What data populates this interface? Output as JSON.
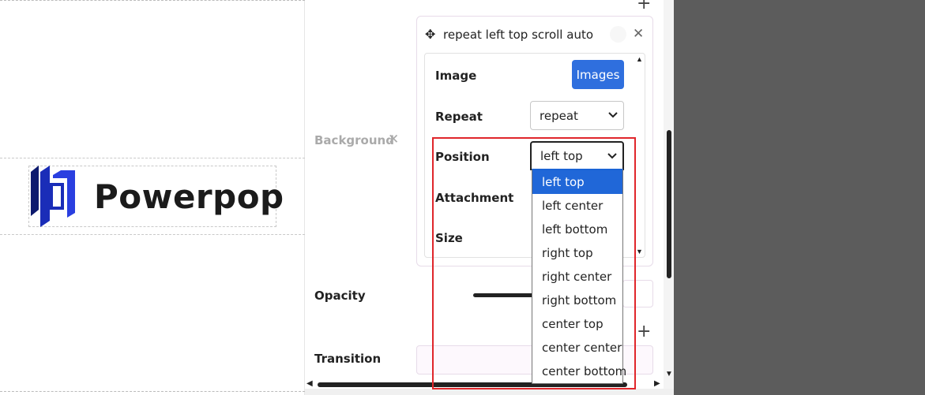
{
  "canvas": {
    "logo_text": "Powerpop",
    "logo_colors": {
      "mark": "#1a2db8",
      "text": "#1b1b1b"
    }
  },
  "panel": {
    "background": {
      "label": "Background",
      "remove_icon": "close-icon",
      "layer": {
        "title": "repeat left top scroll auto",
        "move_icon": "move-icon",
        "close_icon": "close-icon",
        "properties": {
          "image_label": "Image",
          "images_button": "Images",
          "repeat_label": "Repeat",
          "repeat_value": "repeat",
          "position_label": "Position",
          "position_value": "left top",
          "attachment_label": "Attachment",
          "size_label": "Size"
        }
      },
      "position_options": [
        "left top",
        "left center",
        "left bottom",
        "right top",
        "right center",
        "right bottom",
        "center top",
        "center center",
        "center bottom"
      ],
      "selected_option_index": 0
    },
    "opacity_label": "Opacity",
    "transition_label": "Transition",
    "add_icon": "plus-icon"
  },
  "colors": {
    "accent": "#2f6fde",
    "selected_option": "#2067d8",
    "highlight_border": "#e0262b",
    "dark_background": "#5c5c5c"
  }
}
